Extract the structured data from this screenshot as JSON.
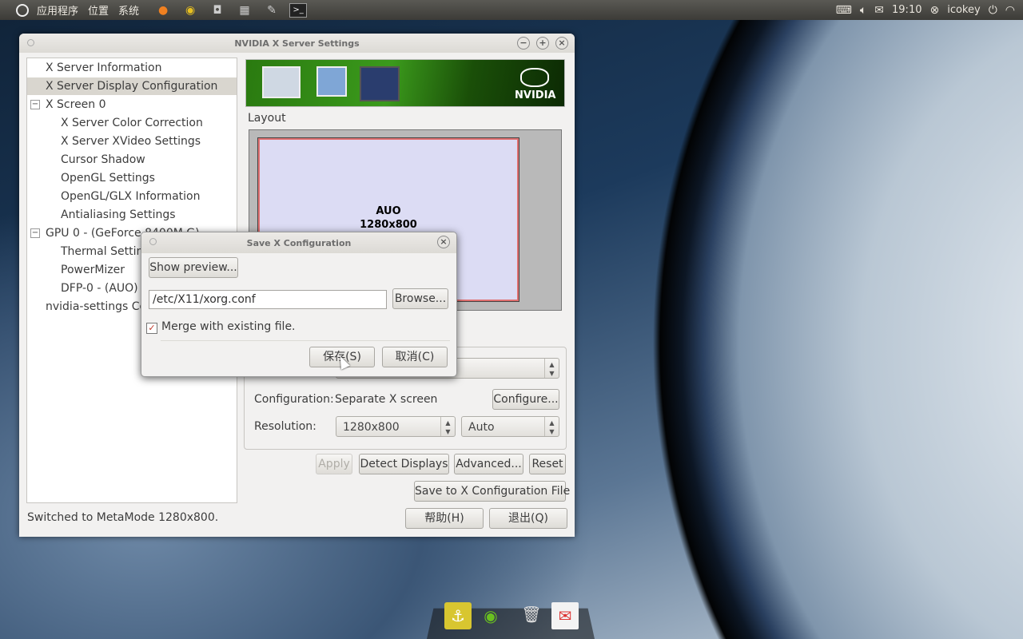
{
  "top_panel": {
    "menus": [
      "应用程序",
      "位置",
      "系统"
    ],
    "launchers": [
      "firefox-icon",
      "chrome-icon",
      "disk-icon",
      "calculator-icon",
      "text-editor-icon",
      "terminal-icon"
    ],
    "clock": "19:10",
    "user": "icokey"
  },
  "main_window": {
    "title": "NVIDIA X Server Settings",
    "tree": [
      "X Server Information",
      "X Server Display Configuration",
      "X Screen 0",
      "X Server Color Correction",
      "X Server XVideo Settings",
      "Cursor Shadow",
      "OpenGL Settings",
      "OpenGL/GLX Information",
      "Antialiasing Settings",
      "GPU 0 - (GeForce 8400M G)",
      "Thermal Settings",
      "PowerMizer",
      "DFP-0 - (AUO)",
      "nvidia-settings Configuration"
    ],
    "banner_brand": "NVIDIA",
    "layout_label": "Layout",
    "display_name": "AUO",
    "display_res": "1280x800",
    "configuration_label": "Configuration:",
    "configuration_value": "Separate X screen",
    "configure_button": "Configure...",
    "resolution_label": "Resolution:",
    "resolution_value": "1280x800",
    "refresh_value": "Auto",
    "apply_button": "Apply",
    "detect_button": "Detect Displays",
    "advanced_button": "Advanced...",
    "reset_button": "Reset",
    "save_config_button": "Save to X Configuration File",
    "status": "Switched to MetaMode 1280x800.",
    "help_button": "帮助(H)",
    "quit_button": "退出(Q)"
  },
  "dialog": {
    "title": "Save X Configuration",
    "preview_button": "Show preview...",
    "path_value": "/etc/X11/xorg.conf",
    "browse_button": "Browse...",
    "merge_label": "Merge with existing file.",
    "merge_checked": true,
    "save_button": "保存(S)",
    "cancel_button": "取消(C)"
  },
  "dock": [
    "anchor-icon",
    "nvidia-icon",
    "trash-icon",
    "gmail-icon"
  ]
}
